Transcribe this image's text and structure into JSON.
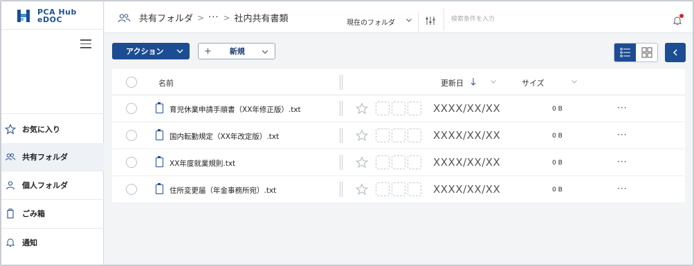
{
  "app": {
    "logo_line1": "PCA Hub",
    "logo_line2": "eDOC",
    "brand_color": "#1c4d92"
  },
  "sidebar": {
    "items": [
      {
        "label": "お気に入り",
        "icon": "star-icon",
        "active": false
      },
      {
        "label": "共有フォルダ",
        "icon": "users-icon",
        "active": true
      },
      {
        "label": "個人フォルダ",
        "icon": "user-icon",
        "active": false
      },
      {
        "label": "ごみ箱",
        "icon": "trash-icon",
        "active": false
      },
      {
        "label": "通知",
        "icon": "bell-icon",
        "active": false
      }
    ]
  },
  "header": {
    "breadcrumb_root": "共有フォルダ",
    "breadcrumb_sep": ">",
    "breadcrumb_ellipsis": "···",
    "breadcrumb_current": "社内共有書類",
    "scope": "現在のフォルダ",
    "search_placeholder": "検索条件を入力"
  },
  "toolbar": {
    "action_label": "アクション",
    "new_plus": "+",
    "new_label": "新規"
  },
  "table": {
    "columns": {
      "name": "名前",
      "updated": "更新日",
      "size": "サイズ"
    },
    "rows": [
      {
        "name": "育児休業申請手順書（XX年修正版）.txt",
        "date": "XXXX/XX/XX",
        "size": "0 B",
        "more": "···"
      },
      {
        "name": "国内転勤規定（XX年改定版）.txt",
        "date": "XXXX/XX/XX",
        "size": "0 B",
        "more": "···"
      },
      {
        "name": "XX年度就業規則.txt",
        "date": "XXXX/XX/XX",
        "size": "0 B",
        "more": "···"
      },
      {
        "name": "住所変更届（年金事務所宛）.txt",
        "date": "XXXX/XX/XX",
        "size": "0 B",
        "more": "···"
      }
    ]
  }
}
